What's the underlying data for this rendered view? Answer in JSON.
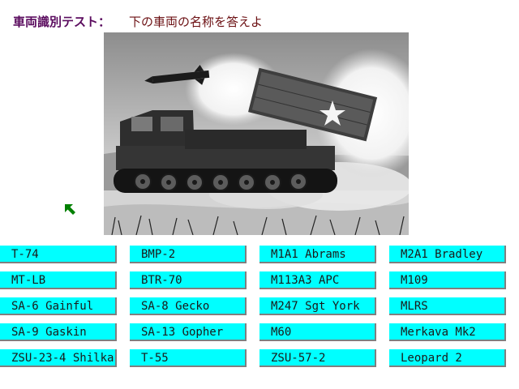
{
  "header": {
    "title": "車両識別テスト：",
    "prompt": "下の車両の名称を答えよ"
  },
  "photo": {
    "subject": "rocket launcher vehicle firing (black and white photo)"
  },
  "cursor": {
    "icon": "arrow-pointer-icon",
    "color": "#008000"
  },
  "answers": {
    "rows": [
      [
        "T-74",
        "BMP-2",
        "M1A1 Abrams",
        "M2A1 Bradley"
      ],
      [
        "MT-LB",
        "BTR-70",
        "M113A3 APC",
        "M109"
      ],
      [
        "SA-6 Gainful",
        "SA-8 Gecko",
        "M247 Sgt York",
        "MLRS"
      ],
      [
        "SA-9 Gaskin",
        "SA-13 Gopher",
        "M60",
        "Merkava Mk2"
      ],
      [
        "ZSU-23-4 Shilka",
        "T-55",
        "ZSU-57-2",
        "Leopard 2"
      ]
    ]
  },
  "colors": {
    "button_bg": "#00ffff",
    "title": "#5a0b5e",
    "prompt": "#6b0f12"
  }
}
